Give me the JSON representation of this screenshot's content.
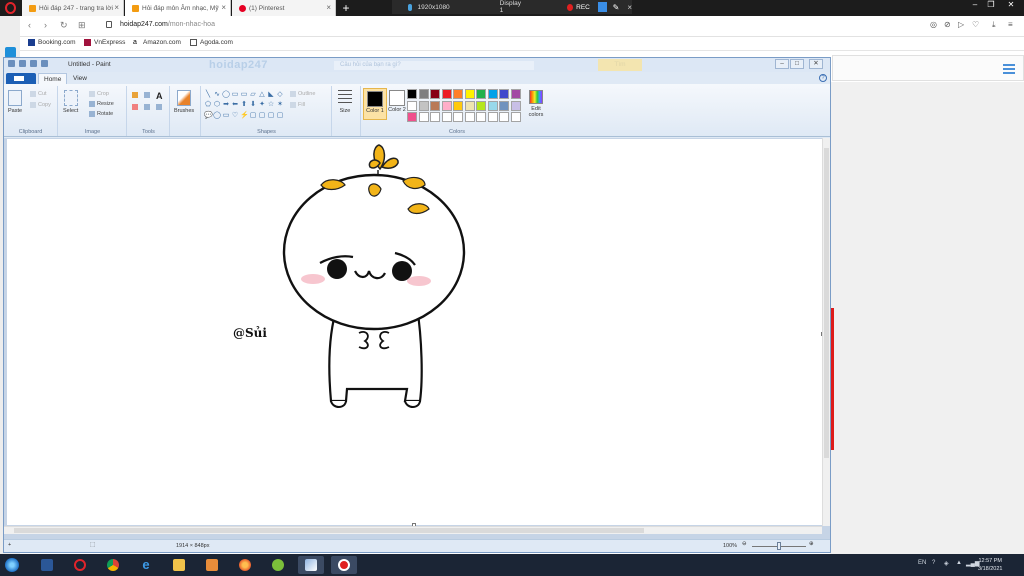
{
  "browser": {
    "tabs": [
      {
        "label": "Hỏi đáp 247 - trang tra lời",
        "icon": "hoidap-favicon"
      },
      {
        "label": "Hỏi đáp môn Âm nhạc, Mỹ",
        "icon": "hoidap-favicon"
      },
      {
        "label": "(1) Pinterest",
        "icon": "pinterest-icon"
      }
    ],
    "new_tab": "+",
    "url_host": "hoidap247.com",
    "url_path": "/mon-nhac-hoa",
    "bookmarks": [
      "Booking.com",
      "VnExpress",
      "Amazon.com",
      "Agoda.com"
    ]
  },
  "recorder": {
    "resolution": "1920x1080",
    "display": "Display 1",
    "rec": "REC"
  },
  "paint": {
    "title": "Untitled - Paint",
    "site_watermark": "hoidap247",
    "site_search": "Câu hỏi của bạn ra gì?",
    "site_button": "Tìm",
    "tabs": {
      "home": "Home",
      "view": "View"
    },
    "clipboard": {
      "paste": "Paste",
      "cut": "Cut",
      "copy": "Copy",
      "label": "Clipboard"
    },
    "image": {
      "select": "Select",
      "crop": "Crop",
      "resize": "Resize",
      "rotate": "Rotate",
      "label": "Image"
    },
    "tools": {
      "label": "Tools"
    },
    "brushes": "Brushes",
    "shapes": {
      "outline": "Outline",
      "fill": "Fill",
      "label": "Shapes"
    },
    "size": "Size",
    "color1": "Color 1",
    "color2": "Color 2",
    "colors_label": "Colors",
    "edit_colors": "Edit colors",
    "signature": "@Sủi",
    "status_dimensions": "1914 × 848px",
    "zoom": "100%",
    "palette": [
      "#000000",
      "#7f7f7f",
      "#880015",
      "#ed1c24",
      "#ff7f27",
      "#fff200",
      "#22b14c",
      "#00a2e8",
      "#3f48cc",
      "#a349a4",
      "#ffffff",
      "#c3c3c3",
      "#b97a57",
      "#ffaec9",
      "#ffc90e",
      "#efe4b0",
      "#b5e61d",
      "#99d9ea",
      "#7092be",
      "#c8bfe7",
      "#f0508c",
      "#ffffff",
      "#ffffff",
      "#ffffff",
      "#ffffff",
      "#ffffff",
      "#ffffff",
      "#ffffff",
      "#ffffff",
      "#ffffff"
    ],
    "color1_value": "#000000",
    "color2_value": "#ffffff"
  },
  "taskbar": {
    "lang": "EN",
    "time": "12:57 PM",
    "date": "3/18/2021"
  }
}
